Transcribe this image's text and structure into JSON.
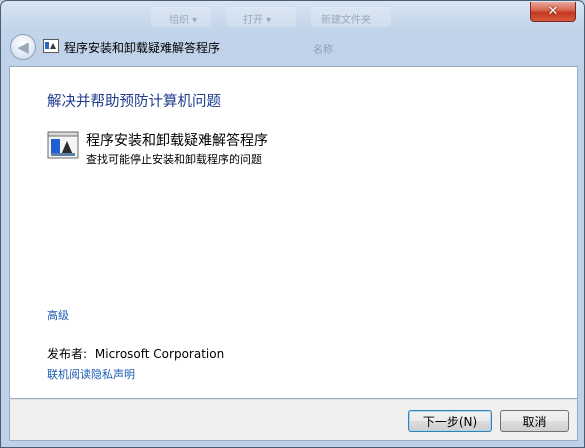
{
  "window": {
    "title": "程序安装和卸载疑难解答程序",
    "close_symbol": "✕",
    "back_symbol": "◀",
    "background_text": [
      "组织 ▾",
      "打开 ▾",
      "新建文件夹",
      "名称"
    ]
  },
  "content": {
    "heading": "解决并帮助预防计算机问题",
    "task": {
      "icon": "troubleshooter-icon",
      "title": "程序安装和卸载疑难解答程序",
      "description": "查找可能停止安装和卸载程序的问题"
    },
    "advanced_link": "高级",
    "publisher_label": "发布者:",
    "publisher_name": "Microsoft Corporation",
    "privacy_link": "联机阅读隐私声明"
  },
  "footer": {
    "next_button": "下一步(N)",
    "cancel_button": "取消"
  },
  "colors": {
    "heading": "#1e3c8c",
    "link": "#1a5bb5",
    "close": "#c2381f"
  }
}
